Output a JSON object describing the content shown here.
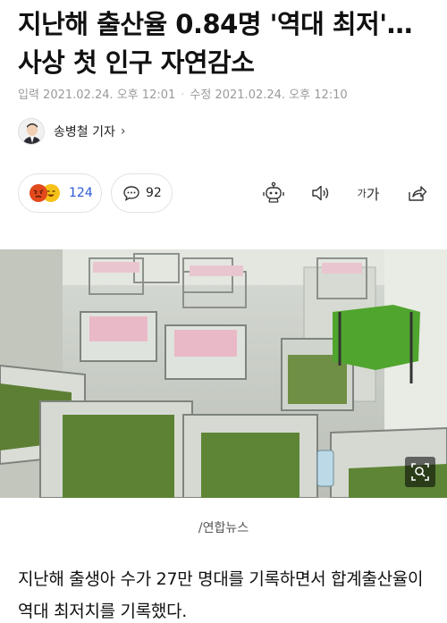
{
  "article": {
    "headline": "지난해 출산율 0.84명 '역대 최저'…사상 첫 인구 자연감소",
    "input_time": "입력 2021.02.24. 오후 12:01",
    "modified_time": "수정 2021.02.24. 오후 12:10",
    "meta_separator": "·"
  },
  "reporter": {
    "name": "송병철 기자",
    "chevron": "›"
  },
  "reactions": {
    "emojis": [
      "angry-emoji-icon",
      "laughing-emoji-icon"
    ],
    "count": "124"
  },
  "comments": {
    "count": "92"
  },
  "toolbar": {
    "icons": [
      "robot-summary-icon",
      "speaker-icon",
      "font-size-icon",
      "share-icon"
    ],
    "font_label_small": "가",
    "font_label_big": "가"
  },
  "photo": {
    "caption": "/연합뉴스",
    "zoom_icon": "zoom-icon"
  },
  "body": {
    "paragraph": "지난해 출생아 수가 27만 명대를 기록하면서 합계출산율이 역대 최저치를 기록했다."
  },
  "colors": {
    "accent_blue": "#2d5bd8",
    "meta_gray": "#9a9a9a"
  }
}
